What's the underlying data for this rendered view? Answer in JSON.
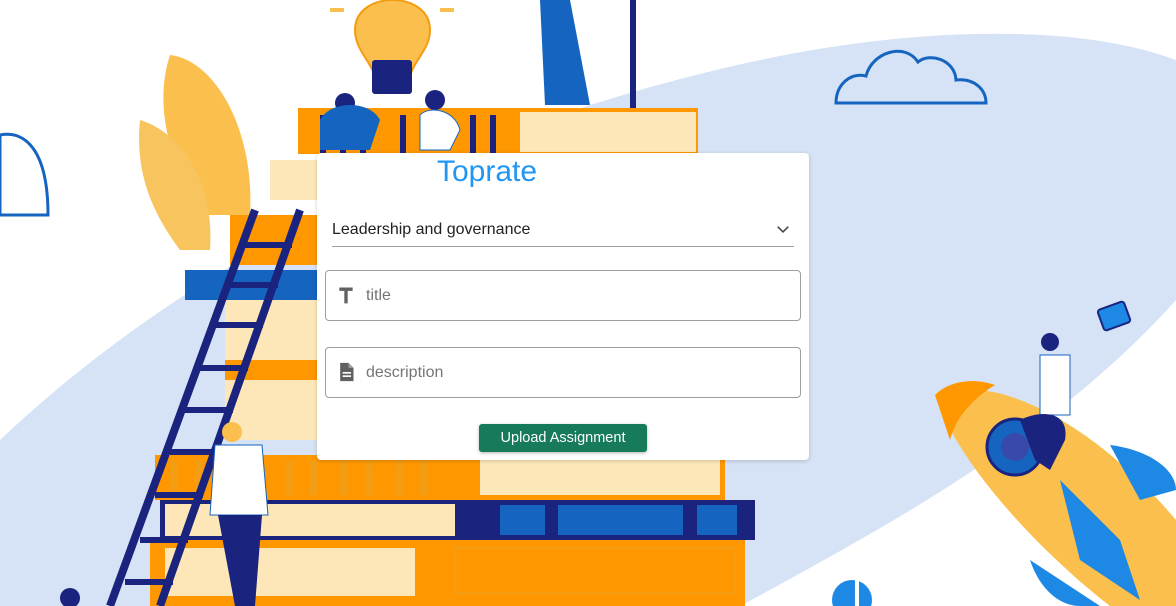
{
  "app": {
    "brand": "Toprate"
  },
  "form": {
    "category": {
      "selected": "Leadership and governance"
    },
    "title_field": {
      "placeholder": "title",
      "value": ""
    },
    "description_field": {
      "placeholder": "description",
      "value": ""
    },
    "submit_label": "Upload Assignment"
  },
  "icons": {
    "title_field": "text-format-icon",
    "description_field": "document-icon",
    "category_select": "chevron-down-icon"
  },
  "colors": {
    "brand": "#2196f3",
    "button": "#167a5b",
    "illustration_blue": "#1565c0",
    "illustration_orange": "#ff9800",
    "illustration_cream": "#fde7b8",
    "illustration_sky": "#d6e2f5"
  }
}
